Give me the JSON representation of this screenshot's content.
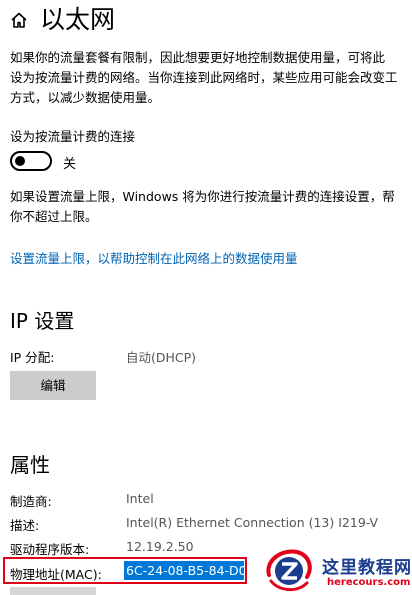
{
  "header": {
    "title": "以太网",
    "home_icon": "home-icon"
  },
  "metered": {
    "description_lines": [
      "如果你的流量套餐有限制，因此想要更好地控制数据使用量，可将此",
      "设为按流量计费的网络。当你连接到此网络时，某些应用可能会改变工",
      "方式，以减少数据使用量。"
    ],
    "toggle_label": "设为按流量计费的连接",
    "toggle_state": "关",
    "toggle_on": false,
    "limit_lines": [
      "如果设置流量上限，Windows 将为你进行按流量计费的连接设置，帮",
      "你不超过上限。"
    ],
    "link_text": "设置流量上限，以帮助控制在此网络上的数据使用量"
  },
  "ip": {
    "title": "IP 设置",
    "assignment_label": "IP 分配:",
    "assignment_value": "自动(DHCP)",
    "edit_button": "编辑"
  },
  "properties": {
    "title": "属性",
    "manufacturer_label": "制造商:",
    "manufacturer_value": "Intel",
    "description_label": "描述:",
    "description_value": "Intel(R) Ethernet Connection (13) I219-V",
    "driver_label": "驱动程序版本:",
    "driver_value": "12.19.2.50",
    "mac_label": "物理地址(MAC):",
    "mac_value": "6C-24-08-B5-84-D0"
  },
  "watermark": {
    "name_cn": "这里教程网",
    "url": "herecours.com"
  },
  "colors": {
    "link": "#0063b1",
    "selection": "#0078d7",
    "highlight_box": "#e0001a",
    "button_bg": "#cccccc"
  }
}
